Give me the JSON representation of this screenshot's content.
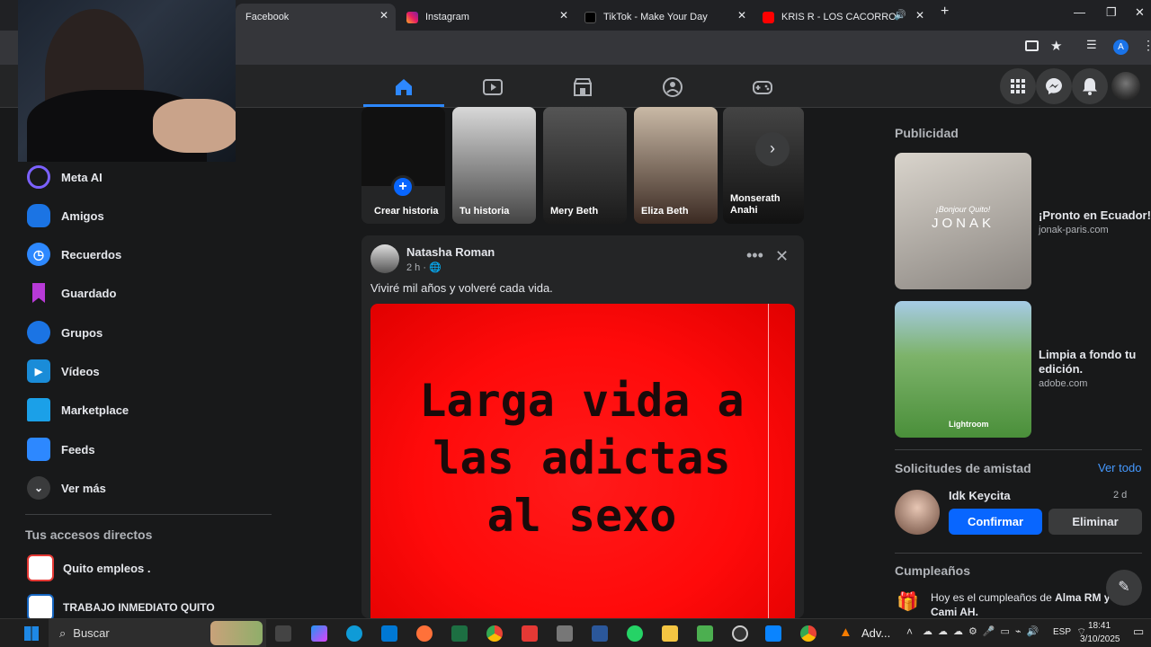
{
  "tabs": [
    {
      "title": "Facebook",
      "active": true
    },
    {
      "title": "Instagram",
      "active": false
    },
    {
      "title": "TikTok - Make Your Day",
      "active": false
    },
    {
      "title": "KRIS R - LOS CACORROS US",
      "active": false
    }
  ],
  "sidebar": {
    "items": [
      {
        "label": "Meta AI",
        "icon": "meta-ai-icon"
      },
      {
        "label": "Amigos",
        "icon": "friends-icon"
      },
      {
        "label": "Recuerdos",
        "icon": "memories-icon"
      },
      {
        "label": "Guardado",
        "icon": "bookmark-icon"
      },
      {
        "label": "Grupos",
        "icon": "groups-icon"
      },
      {
        "label": "Vídeos",
        "icon": "video-icon"
      },
      {
        "label": "Marketplace",
        "icon": "marketplace-icon"
      },
      {
        "label": "Feeds",
        "icon": "feeds-icon"
      },
      {
        "label": "Ver más",
        "icon": "chevron-down-icon"
      }
    ],
    "shortcuts_title": "Tus accesos directos",
    "shortcuts": [
      {
        "label": "Quito empleos ."
      },
      {
        "label": "TRABAJO INMEDIATO QUITO"
      }
    ]
  },
  "stories": [
    {
      "name": "Crear historia"
    },
    {
      "name": "Tu historia"
    },
    {
      "name": "Mery Beth"
    },
    {
      "name": "Eliza Beth"
    },
    {
      "name": "Monserath Anahi"
    }
  ],
  "post": {
    "author": "Natasha Roman",
    "time": "2 h ·",
    "text": "Viviré mil años y volveré cada vida.",
    "image_text": "Larga vida a las adictas al sexo"
  },
  "right": {
    "ads_title": "Publicidad",
    "ads": [
      {
        "title": "¡Pronto en Ecuador!",
        "domain": "jonak-paris.com",
        "brand": "JONAK",
        "tagline": "¡Bonjour Quito!"
      },
      {
        "title": "Limpia a fondo tu edición.",
        "domain": "adobe.com",
        "brand": "Lightroom"
      }
    ],
    "requests_title": "Solicitudes de amistad",
    "see_all": "Ver todo",
    "request": {
      "name": "Idk Keycita",
      "time": "2 d",
      "confirm": "Confirmar",
      "delete": "Eliminar"
    },
    "birthdays_title": "Cumpleaños",
    "birthday_text": "Hoy es el cumpleaños de",
    "birthday_names": "Alma RM y Cami AH."
  },
  "taskbar": {
    "search": "Buscar",
    "adv": "Adv...",
    "lang": "ESP",
    "time": "18:41",
    "date": "3/10/2025"
  }
}
